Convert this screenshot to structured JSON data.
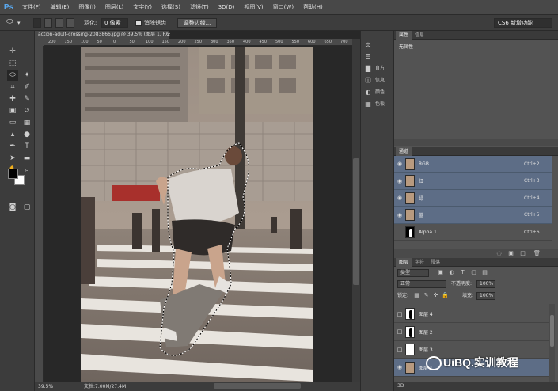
{
  "app": {
    "logo": "Ps"
  },
  "menu": [
    "文件(F)",
    "编辑(E)",
    "图像(I)",
    "图层(L)",
    "文字(Y)",
    "选择(S)",
    "滤镜(T)",
    "3D(D)",
    "视图(V)",
    "窗口(W)",
    "帮助(H)"
  ],
  "options": {
    "feather_label": "羽化:",
    "feather_value": "0 像素",
    "antialias_label": "消除锯齿",
    "refine_button": "调整边缘...",
    "workspace": "CS6 新增功能"
  },
  "document": {
    "tab_title": "action-adult-crossing-2083866.jpg @ 39.5% (图层 1, RGB/8)",
    "close_glyph": "×",
    "zoom": "39.5%",
    "doc_size": "文档:7.00M/27.4M"
  },
  "ruler_ticks": [
    "200",
    "150",
    "100",
    "50",
    "0",
    "50",
    "100",
    "150",
    "200",
    "250",
    "300",
    "350",
    "400",
    "450",
    "500",
    "550",
    "600",
    "650",
    "700"
  ],
  "dock": [
    {
      "icon": "adjust-icon",
      "label": ""
    },
    {
      "icon": "sliders-icon",
      "label": ""
    },
    {
      "icon": "histogram-icon",
      "label": "直方"
    },
    {
      "icon": "info-icon",
      "label": "信息"
    },
    {
      "icon": "color-icon",
      "label": "颜色"
    },
    {
      "icon": "swatches-icon",
      "label": "色板"
    }
  ],
  "properties_panel": {
    "tabs": [
      "属性",
      "信息"
    ],
    "body_text": "无属性"
  },
  "channels_panel": {
    "tab": "通道",
    "channels": [
      {
        "name": "RGB",
        "shortcut": "Ctrl+2",
        "selected": true
      },
      {
        "name": "红",
        "shortcut": "Ctrl+3",
        "selected": true
      },
      {
        "name": "绿",
        "shortcut": "Ctrl+4",
        "selected": true
      },
      {
        "name": "蓝",
        "shortcut": "Ctrl+5",
        "selected": true
      },
      {
        "name": "Alpha 1",
        "shortcut": "Ctrl+6",
        "selected": false
      }
    ]
  },
  "layers_panel": {
    "tabs": [
      "图层",
      "字符",
      "段落"
    ],
    "filter_kind": "类型",
    "blend_mode": "正常",
    "opacity_label": "不透明度:",
    "opacity_value": "100%",
    "lock_label": "锁定:",
    "fill_label": "填充:",
    "fill_value": "100%",
    "layers": [
      {
        "name": "图层 4",
        "thumb": "bw"
      },
      {
        "name": "图层 2",
        "thumb": "bw"
      },
      {
        "name": "图层 3",
        "thumb": "white"
      },
      {
        "name": "图层 1",
        "thumb": "photo"
      }
    ]
  },
  "bottom_label": "3D",
  "watermark": "UiBQ.实训教程"
}
